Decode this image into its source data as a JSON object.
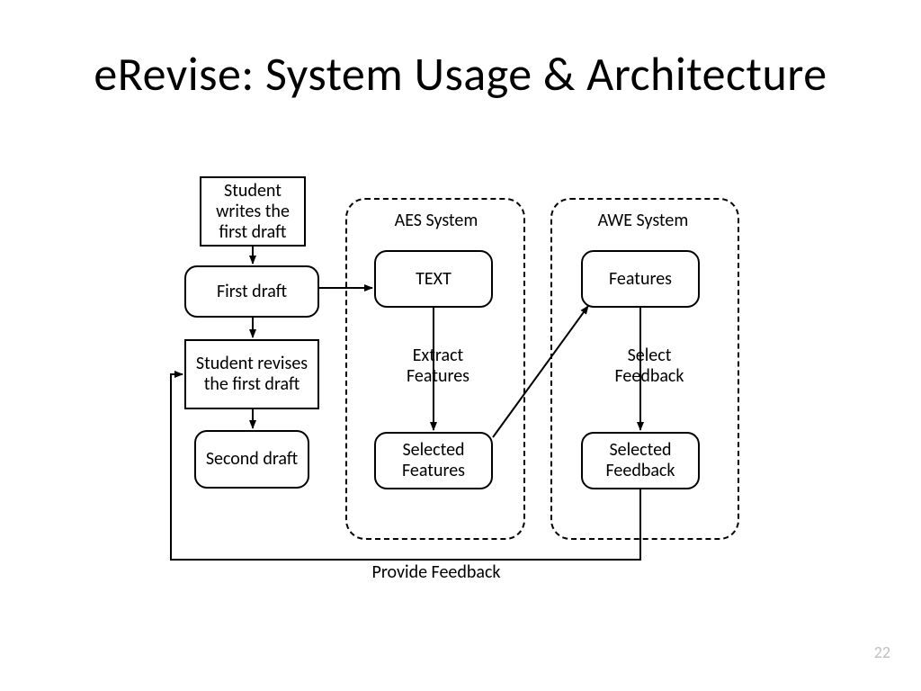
{
  "title": "eRevise: System Usage & Architecture",
  "page_number": "22",
  "boxes": {
    "student_writes": "Student writes the first draft",
    "first_draft": "First draft",
    "student_revises": "Student revises the first draft",
    "second_draft": "Second draft",
    "text": "TEXT",
    "selected_features": "Selected Features",
    "features": "Features",
    "selected_feedback": "Selected Feedback"
  },
  "groups": {
    "aes": "AES System",
    "awe": "AWE System"
  },
  "edges": {
    "extract_features": "Extract Features",
    "select_feedback": "Select Feedback",
    "provide_feedback": "Provide Feedback"
  }
}
